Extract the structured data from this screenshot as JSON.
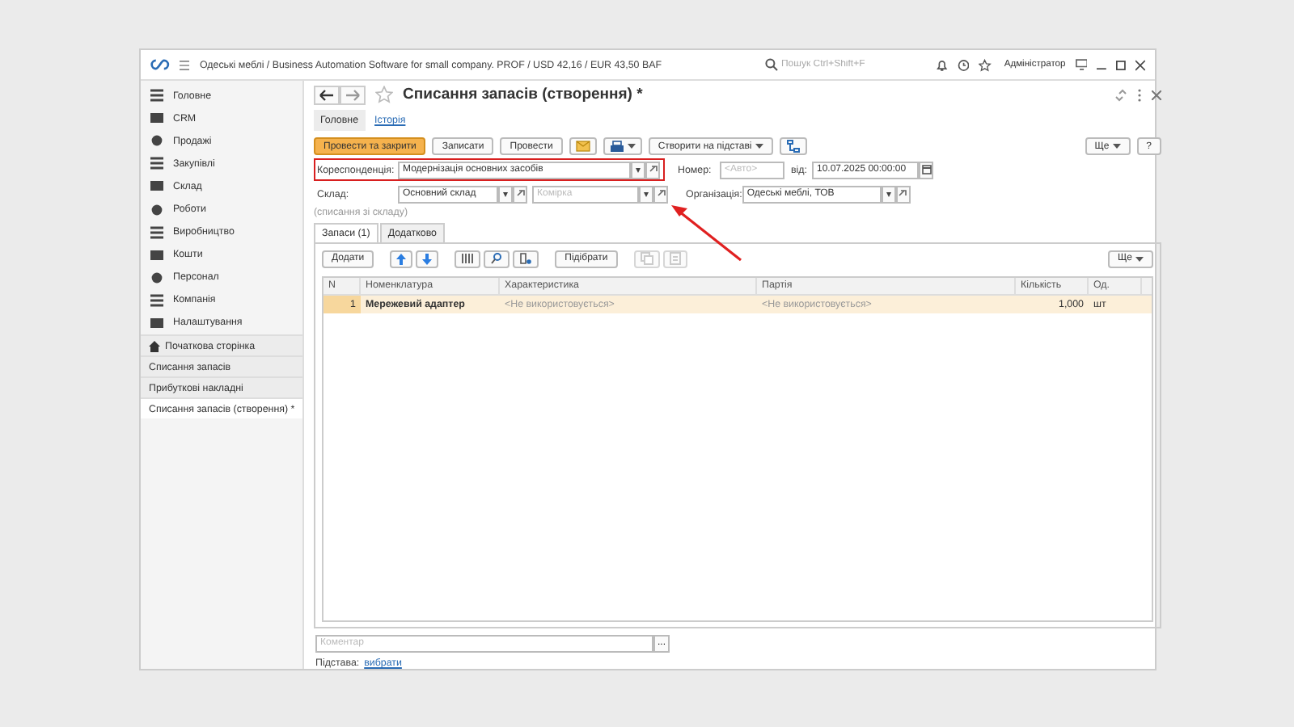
{
  "window": {
    "title": "Одеські меблі / Business Automation Software for small company. PROF / USD 42,16 / EUR 43,50 BAF",
    "search": {
      "placeholder": "Пошук Ctrl+Shift+F"
    },
    "user": "Адміністратор"
  },
  "sidebar": {
    "sections": [
      {
        "label": "Головне"
      },
      {
        "label": "CRM"
      },
      {
        "label": "Продажі"
      },
      {
        "label": "Закупівлі"
      },
      {
        "label": "Склад"
      },
      {
        "label": "Роботи"
      },
      {
        "label": "Виробництво"
      },
      {
        "label": "Кошти"
      },
      {
        "label": "Персонал"
      },
      {
        "label": "Компанія"
      },
      {
        "label": "Налаштування"
      }
    ],
    "open_windows": [
      {
        "label": "Початкова сторінка",
        "selected": false
      },
      {
        "label": "Списання запасів",
        "selected": false
      },
      {
        "label": "Прибуткові накладні",
        "selected": false
      },
      {
        "label": "Списання запасів (створення) *",
        "selected": true
      }
    ]
  },
  "document": {
    "title": "Списання запасів (створення) *",
    "tabs": [
      {
        "label": "Головне",
        "selected": true
      },
      {
        "label": "Історія",
        "selected": false
      }
    ],
    "actions": [
      {
        "kind": "primary",
        "label": "Провести та закрити"
      },
      {
        "kind": "button",
        "label": "Записати"
      },
      {
        "kind": "button",
        "label": "Провести"
      },
      {
        "kind": "mail"
      },
      {
        "kind": "print"
      },
      {
        "kind": "dropdown",
        "label": "Створити на підставі"
      },
      {
        "kind": "structure"
      }
    ],
    "more": "Ще",
    "help": "?",
    "correspondent": {
      "label": "Кореспонденція:",
      "value": "Модернізація основних засобів",
      "highlighted": true
    },
    "number": {
      "label": "Номер:",
      "placeholder": "<Авто>"
    },
    "date": {
      "label": "від:",
      "value": "10.07.2025 00:00:00"
    },
    "warehouse": {
      "label": "Склад:",
      "value": "Основний склад"
    },
    "cell": {
      "placeholder": "Комірка"
    },
    "organization": {
      "label": "Організація:",
      "value": "Одеські меблі, ТОВ"
    },
    "operation": "(списання зі складу)",
    "inner_tabs": [
      {
        "label": "Запаси (1)",
        "selected": true
      },
      {
        "label": "Додатково",
        "selected": false
      }
    ],
    "table_toolbar": {
      "add": "Додати",
      "pick": "Підібрати",
      "more": "Ще"
    },
    "table": {
      "columns": [
        "N",
        "Номенклатура",
        "Характеристика",
        "Партія",
        "Кількість",
        "Од."
      ],
      "rows": [
        {
          "cells": [
            "1",
            "Мережевий адаптер",
            "<Не використовується>",
            "<Не використовується>",
            "1,000",
            "шт"
          ],
          "selected": true
        }
      ]
    },
    "comment": {
      "placeholder": "Коментар",
      "button": "..."
    },
    "basis": {
      "label": "Підстава:",
      "link": "вибрати"
    }
  }
}
